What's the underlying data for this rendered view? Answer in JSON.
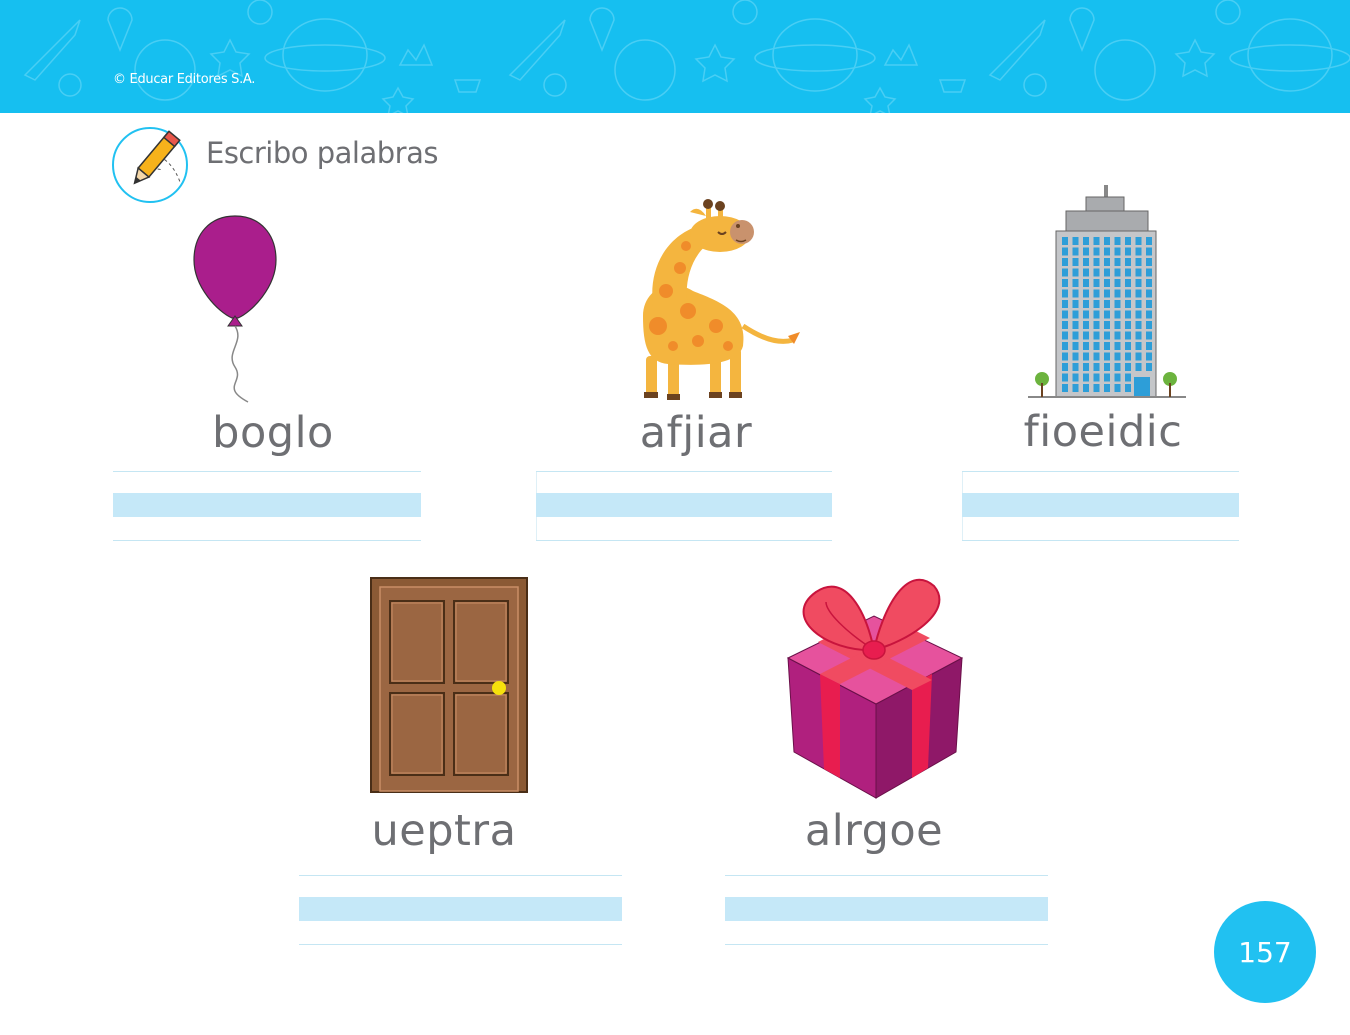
{
  "header": {
    "copyright": "© Educar Editores S.A.",
    "background_color": "#16bff0",
    "decor_icons": [
      "rocket-icon",
      "planet-icon",
      "star-icon",
      "ice-cream-icon",
      "bunny-icon",
      "cupcake-icon",
      "crown-icon",
      "globe-icon"
    ]
  },
  "activity": {
    "icon": "pencil-icon",
    "title": "Escribo palabras"
  },
  "items": [
    {
      "icon": "balloon-icon",
      "scrambled_word": "boglo"
    },
    {
      "icon": "giraffe-icon",
      "scrambled_word": "afjiar"
    },
    {
      "icon": "building-icon",
      "scrambled_word": "fioeidic"
    },
    {
      "icon": "door-icon",
      "scrambled_word": "ueptra"
    },
    {
      "icon": "gift-icon",
      "scrambled_word": "alrgoe"
    }
  ],
  "page_number": "157",
  "colors": {
    "accent": "#21c1f1",
    "text": "#6e6f73",
    "writing_band": "#c5e8f8"
  }
}
